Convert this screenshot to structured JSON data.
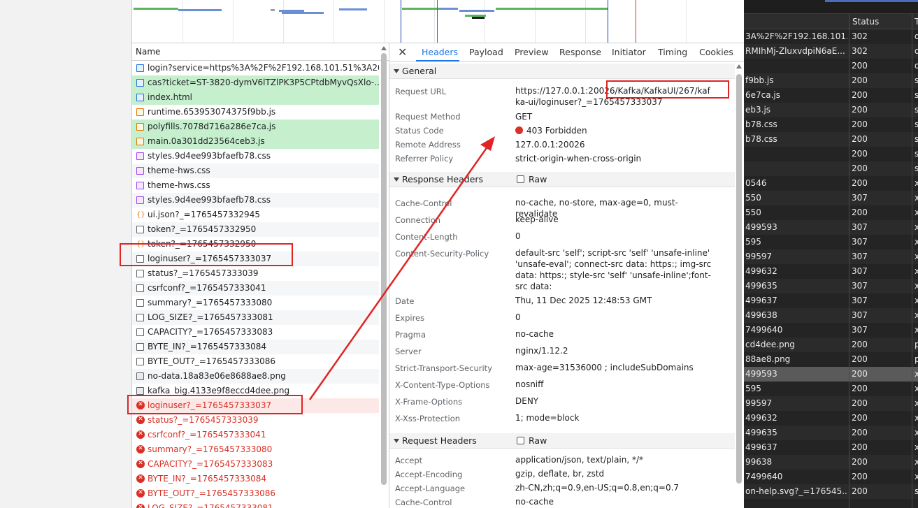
{
  "name_panel": {
    "header": "Name",
    "requests": [
      {
        "name": "login?service=https%3A%2F%2F192.168.101.51%3A20...",
        "icon": "doc",
        "style": "normal"
      },
      {
        "name": "cas?ticket=ST-3820-dymV6lTZlPK3P5CPtdbMyvQsXlo-...",
        "icon": "doc",
        "style": "green"
      },
      {
        "name": "index.html",
        "icon": "doc",
        "style": "green"
      },
      {
        "name": "runtime.653953074375f9bb.js",
        "icon": "js",
        "style": "normal"
      },
      {
        "name": "polyfills.7078d716a286e7ca.js",
        "icon": "js",
        "style": "green"
      },
      {
        "name": "main.0a301dd23564ceb3.js",
        "icon": "js",
        "style": "green"
      },
      {
        "name": "styles.9d4ee993bfaefb78.css",
        "icon": "css",
        "style": "normal"
      },
      {
        "name": "theme-hws.css",
        "icon": "css",
        "style": "even"
      },
      {
        "name": "theme-hws.css",
        "icon": "css",
        "style": "normal"
      },
      {
        "name": "styles.9d4ee993bfaefb78.css",
        "icon": "css",
        "style": "even"
      },
      {
        "name": "ui.json?_=1765457332945",
        "icon": "json",
        "style": "normal"
      },
      {
        "name": "token?_=1765457332950",
        "icon": "file",
        "style": "even"
      },
      {
        "name": "token?_=1765457332950",
        "icon": "json",
        "style": "normal"
      },
      {
        "name": "loginuser?_=1765457333037",
        "icon": "file",
        "style": "even"
      },
      {
        "name": "status?_=1765457333039",
        "icon": "file",
        "style": "normal"
      },
      {
        "name": "csrfconf?_=1765457333041",
        "icon": "file",
        "style": "even"
      },
      {
        "name": "summary?_=1765457333080",
        "icon": "file",
        "style": "normal"
      },
      {
        "name": "LOG_SIZE?_=1765457333081",
        "icon": "file",
        "style": "even"
      },
      {
        "name": "CAPACITY?_=1765457333083",
        "icon": "file",
        "style": "normal"
      },
      {
        "name": "BYTE_IN?_=1765457333084",
        "icon": "file",
        "style": "even"
      },
      {
        "name": "BYTE_OUT?_=1765457333086",
        "icon": "file",
        "style": "normal"
      },
      {
        "name": "no-data.18a83e06e8688ae8.png",
        "icon": "img",
        "style": "even"
      },
      {
        "name": "kafka_big.4133e9f8eccd4dee.png",
        "icon": "img",
        "style": "normal"
      },
      {
        "name": "loginuser?_=1765457333037",
        "icon": "errc",
        "style": "err-sel"
      },
      {
        "name": "status?_=1765457333039",
        "icon": "errc",
        "style": "err"
      },
      {
        "name": "csrfconf?_=1765457333041",
        "icon": "errc",
        "style": "err"
      },
      {
        "name": "summary?_=1765457333080",
        "icon": "errc",
        "style": "err"
      },
      {
        "name": "CAPACITY?_=1765457333083",
        "icon": "errc",
        "style": "err"
      },
      {
        "name": "BYTE_IN?_=1765457333084",
        "icon": "errc",
        "style": "err"
      },
      {
        "name": "BYTE_OUT?_=1765457333086",
        "icon": "errc",
        "style": "err"
      },
      {
        "name": "LOG_SIZE?_=1765457333081",
        "icon": "errc",
        "style": "err"
      }
    ]
  },
  "tabs": {
    "close": "✕",
    "items": [
      "Headers",
      "Payload",
      "Preview",
      "Response",
      "Initiator",
      "Timing",
      "Cookies"
    ],
    "active": "Headers"
  },
  "general": {
    "title": "General",
    "rows": [
      {
        "key": "Request URL",
        "value": "https://127.0.0.1:20026/Kafka/KafkaUI/267/kafka-ui/loginuser?_=1765457333037"
      },
      {
        "key": "Request Method",
        "value": "GET"
      },
      {
        "key": "Status Code",
        "value": "403 Forbidden"
      },
      {
        "key": "Remote Address",
        "value": "127.0.0.1:20026"
      },
      {
        "key": "Referrer Policy",
        "value": "strict-origin-when-cross-origin"
      }
    ]
  },
  "response_headers": {
    "title": "Response Headers",
    "raw_label": "Raw",
    "rows": [
      {
        "key": "Cache-Control",
        "value": "no-cache, no-store, max-age=0, must-revalidate"
      },
      {
        "key": "Connection",
        "value": "keep-alive"
      },
      {
        "key": "Content-Length",
        "value": "0"
      },
      {
        "key": "Content-Security-Policy",
        "value": "default-src 'self'; script-src 'self' 'unsafe-inline' 'unsafe-eval'; connect-src data: https:; img-src data: https:; style-src 'self' 'unsafe-inline';font-src data:"
      },
      {
        "key": "Date",
        "value": "Thu, 11 Dec 2025 12:48:53 GMT"
      },
      {
        "key": "Expires",
        "value": "0"
      },
      {
        "key": "Pragma",
        "value": "no-cache"
      },
      {
        "key": "Server",
        "value": "nginx/1.12.2"
      },
      {
        "key": "Strict-Transport-Security",
        "value": "max-age=31536000 ; includeSubDomains"
      },
      {
        "key": "X-Content-Type-Options",
        "value": "nosniff"
      },
      {
        "key": "X-Frame-Options",
        "value": "DENY"
      },
      {
        "key": "X-Xss-Protection",
        "value": "1; mode=block"
      }
    ]
  },
  "request_headers": {
    "title": "Request Headers",
    "raw_label": "Raw",
    "rows": [
      {
        "key": "Accept",
        "value": "application/json, text/plain, */*"
      },
      {
        "key": "Accept-Encoding",
        "value": "gzip, deflate, br, zstd"
      },
      {
        "key": "Accept-Language",
        "value": "zh-CN,zh;q=0.9,en-US;q=0.8,en;q=0.7"
      },
      {
        "key": "Cache-Control",
        "value": "no-cache"
      }
    ]
  },
  "right_table": {
    "status_header": "Status",
    "type_header": "T",
    "rows": [
      {
        "name": "3A%2F%2F192.168.101....",
        "status": "302",
        "type": "d"
      },
      {
        "name": "RMIhMj-ZluxvdpiN6aE...",
        "status": "302",
        "type": "d"
      },
      {
        "name": "",
        "status": "200",
        "type": "d"
      },
      {
        "name": "f9bb.js",
        "status": "200",
        "type": "s"
      },
      {
        "name": "6e7ca.js",
        "status": "200",
        "type": "s"
      },
      {
        "name": "eb3.js",
        "status": "200",
        "type": "s"
      },
      {
        "name": "b78.css",
        "status": "200",
        "type": "s"
      },
      {
        "name": "b78.css",
        "status": "200",
        "type": "s"
      },
      {
        "name": "",
        "status": "200",
        "type": "s"
      },
      {
        "name": "",
        "status": "200",
        "type": "s"
      },
      {
        "name": "0546",
        "status": "200",
        "type": "x"
      },
      {
        "name": "550",
        "status": "307",
        "type": "x"
      },
      {
        "name": "550",
        "status": "200",
        "type": "x"
      },
      {
        "name": "499593",
        "status": "307",
        "type": "x"
      },
      {
        "name": "595",
        "status": "307",
        "type": "x"
      },
      {
        "name": "99597",
        "status": "307",
        "type": "x"
      },
      {
        "name": "499632",
        "status": "307",
        "type": "x"
      },
      {
        "name": "499635",
        "status": "307",
        "type": "x"
      },
      {
        "name": "499637",
        "status": "307",
        "type": "x"
      },
      {
        "name": "499638",
        "status": "307",
        "type": "x"
      },
      {
        "name": "7499640",
        "status": "307",
        "type": "x"
      },
      {
        "name": "cd4dee.png",
        "status": "200",
        "type": "p"
      },
      {
        "name": "88ae8.png",
        "status": "200",
        "type": "p"
      },
      {
        "name": "499593",
        "status": "200",
        "type": "x"
      },
      {
        "name": "595",
        "status": "200",
        "type": "x"
      },
      {
        "name": "99597",
        "status": "200",
        "type": "x"
      },
      {
        "name": "499632",
        "status": "200",
        "type": "x"
      },
      {
        "name": "499635",
        "status": "200",
        "type": "x"
      },
      {
        "name": "499637",
        "status": "200",
        "type": "x"
      },
      {
        "name": "99638",
        "status": "200",
        "type": "x"
      },
      {
        "name": "7499640",
        "status": "200",
        "type": "x"
      },
      {
        "name": "on-help.svg?_=176545...",
        "status": "200",
        "type": "s"
      }
    ]
  },
  "colors": {
    "accent": "#1a73e8",
    "error": "#d93025",
    "annotation": "#e02424",
    "row_green": "#c6efce"
  }
}
